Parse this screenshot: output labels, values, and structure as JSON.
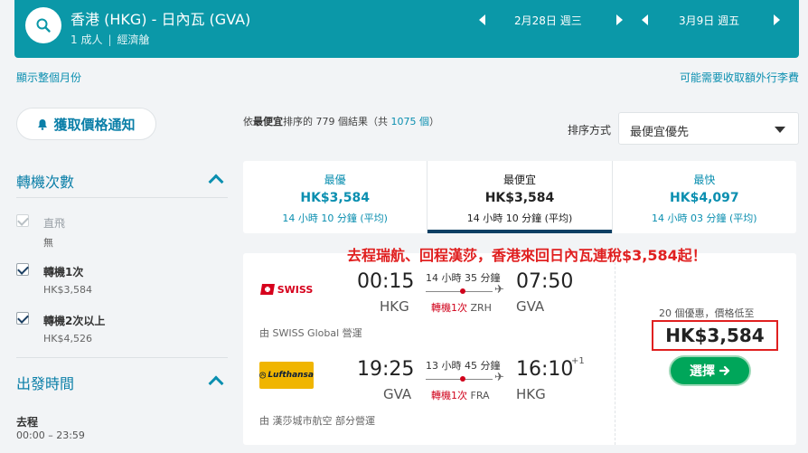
{
  "header": {
    "route": "香港 (HKG) - 日內瓦 (GVA)",
    "passengers": "1 成人",
    "cabin": "經濟艙",
    "depart_date": "2月28日 週三",
    "return_date": "3月9日 週五"
  },
  "links": {
    "show_month": "顯示整個月份",
    "extra_fees": "可能需要收取額外行李費"
  },
  "alert_button": "獲取價格通知",
  "filters": {
    "stops_title": "轉機次數",
    "options": [
      {
        "label": "直飛",
        "sub": "無",
        "checked": true,
        "disabled": true
      },
      {
        "label": "轉機1次",
        "sub": "HK$3,584",
        "checked": true,
        "disabled": false
      },
      {
        "label": "轉機2次以上",
        "sub": "HK$4,526",
        "checked": true,
        "disabled": false
      }
    ],
    "depart_title": "出發時間",
    "outbound_label": "去程",
    "outbound_range": "00:00 – 23:59"
  },
  "results": {
    "prefix": "依",
    "sort_bold": "最便宜",
    "middle": "排序的 779 個結果（共",
    "total": "1075 個",
    "suffix": "）"
  },
  "sort": {
    "label": "排序方式",
    "value": "最便宜優先"
  },
  "tabs": [
    {
      "name": "最優",
      "price": "HK$3,584",
      "duration": "14 小時 10 分鐘 (平均)"
    },
    {
      "name": "最便宜",
      "price": "HK$3,584",
      "duration": "14 小時 10 分鐘 (平均)"
    },
    {
      "name": "最快",
      "price": "HK$4,097",
      "duration": "14 小時 03 分鐘 (平均)"
    }
  ],
  "promo": "去程瑞航、回程漢莎，香港來回日內瓦連稅$3,584起！",
  "legs": [
    {
      "airline": "SWISS",
      "depart_time": "00:15",
      "arrive_time": "07:50",
      "from": "HKG",
      "to": "GVA",
      "duration": "14 小時 35 分鐘",
      "stops": "轉機1次",
      "via": "ZRH",
      "day_offset": "",
      "operated": "由 SWISS Global 營運"
    },
    {
      "airline": "Lufthansa",
      "depart_time": "19:25",
      "arrive_time": "16:10",
      "from": "GVA",
      "to": "HKG",
      "duration": "13 小時 45 分鐘",
      "stops": "轉機1次",
      "via": "FRA",
      "day_offset": "+1",
      "operated": "由 漢莎城市航空 部分營運"
    }
  ],
  "offer": {
    "deals": "20 個優惠，價格低至",
    "price": "HK$3,584",
    "select": "選擇"
  },
  "colors": {
    "header_bg": "#0b98a8",
    "accent": "#0b8fb0",
    "select_btn": "#00a65a",
    "promo": "#e02020"
  }
}
